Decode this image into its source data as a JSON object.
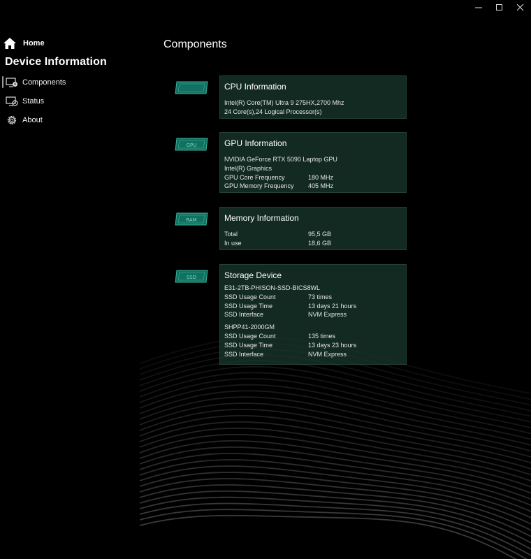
{
  "window": {
    "minimize_icon": "minimize-icon",
    "maximize_icon": "maximize-icon",
    "close_icon": "close-icon"
  },
  "sidebar": {
    "home_label": "Home",
    "section_title": "Device Information",
    "items": [
      {
        "label": "Components",
        "icon": "components-icon",
        "active": true
      },
      {
        "label": "Status",
        "icon": "status-icon"
      },
      {
        "label": "About",
        "icon": "gear-icon"
      }
    ]
  },
  "main": {
    "title": "Components",
    "cpu": {
      "chip_label": "CPU",
      "title": "CPU Information",
      "lines": [
        "Intel(R) Core(TM) Ultra 9 275HX,2700 Mhz",
        "24 Core(s),24 Logical Processor(s)"
      ]
    },
    "gpu": {
      "chip_label": "GPU",
      "title": "GPU Information",
      "lines": [
        "NVIDIA GeForce RTX 5090 Laptop GPU",
        "Intel(R) Graphics"
      ],
      "rows": [
        {
          "label": "GPU Core Frequency",
          "value": "180 MHz"
        },
        {
          "label": "GPU Memory Frequency",
          "value": "405 MHz"
        }
      ]
    },
    "memory": {
      "chip_label": "RAM",
      "title": "Memory Information",
      "rows": [
        {
          "label": "Total",
          "value": "95,5 GB"
        },
        {
          "label": "In use",
          "value": "18,6 GB"
        }
      ]
    },
    "storage": {
      "chip_label": "SSD",
      "title": "Storage Device",
      "devices": [
        {
          "name": "E31-2TB-PHISON-SSD-BICS8WL",
          "rows": [
            {
              "label": "SSD Usage Count",
              "value": "73 times"
            },
            {
              "label": "SSD Usage Time",
              "value": "13 days 21 hours"
            },
            {
              "label": "SSD Interface",
              "value": "NVM Express"
            }
          ]
        },
        {
          "name": "SHPP41-2000GM",
          "rows": [
            {
              "label": "SSD Usage Count",
              "value": "135 times"
            },
            {
              "label": "SSD Usage Time",
              "value": "13 days 23 hours"
            },
            {
              "label": "SSD Interface",
              "value": "NVM Express"
            }
          ]
        }
      ]
    }
  },
  "colors": {
    "card_bg": "#1a3a30",
    "chip": "#1f8f79",
    "background": "#000000"
  }
}
